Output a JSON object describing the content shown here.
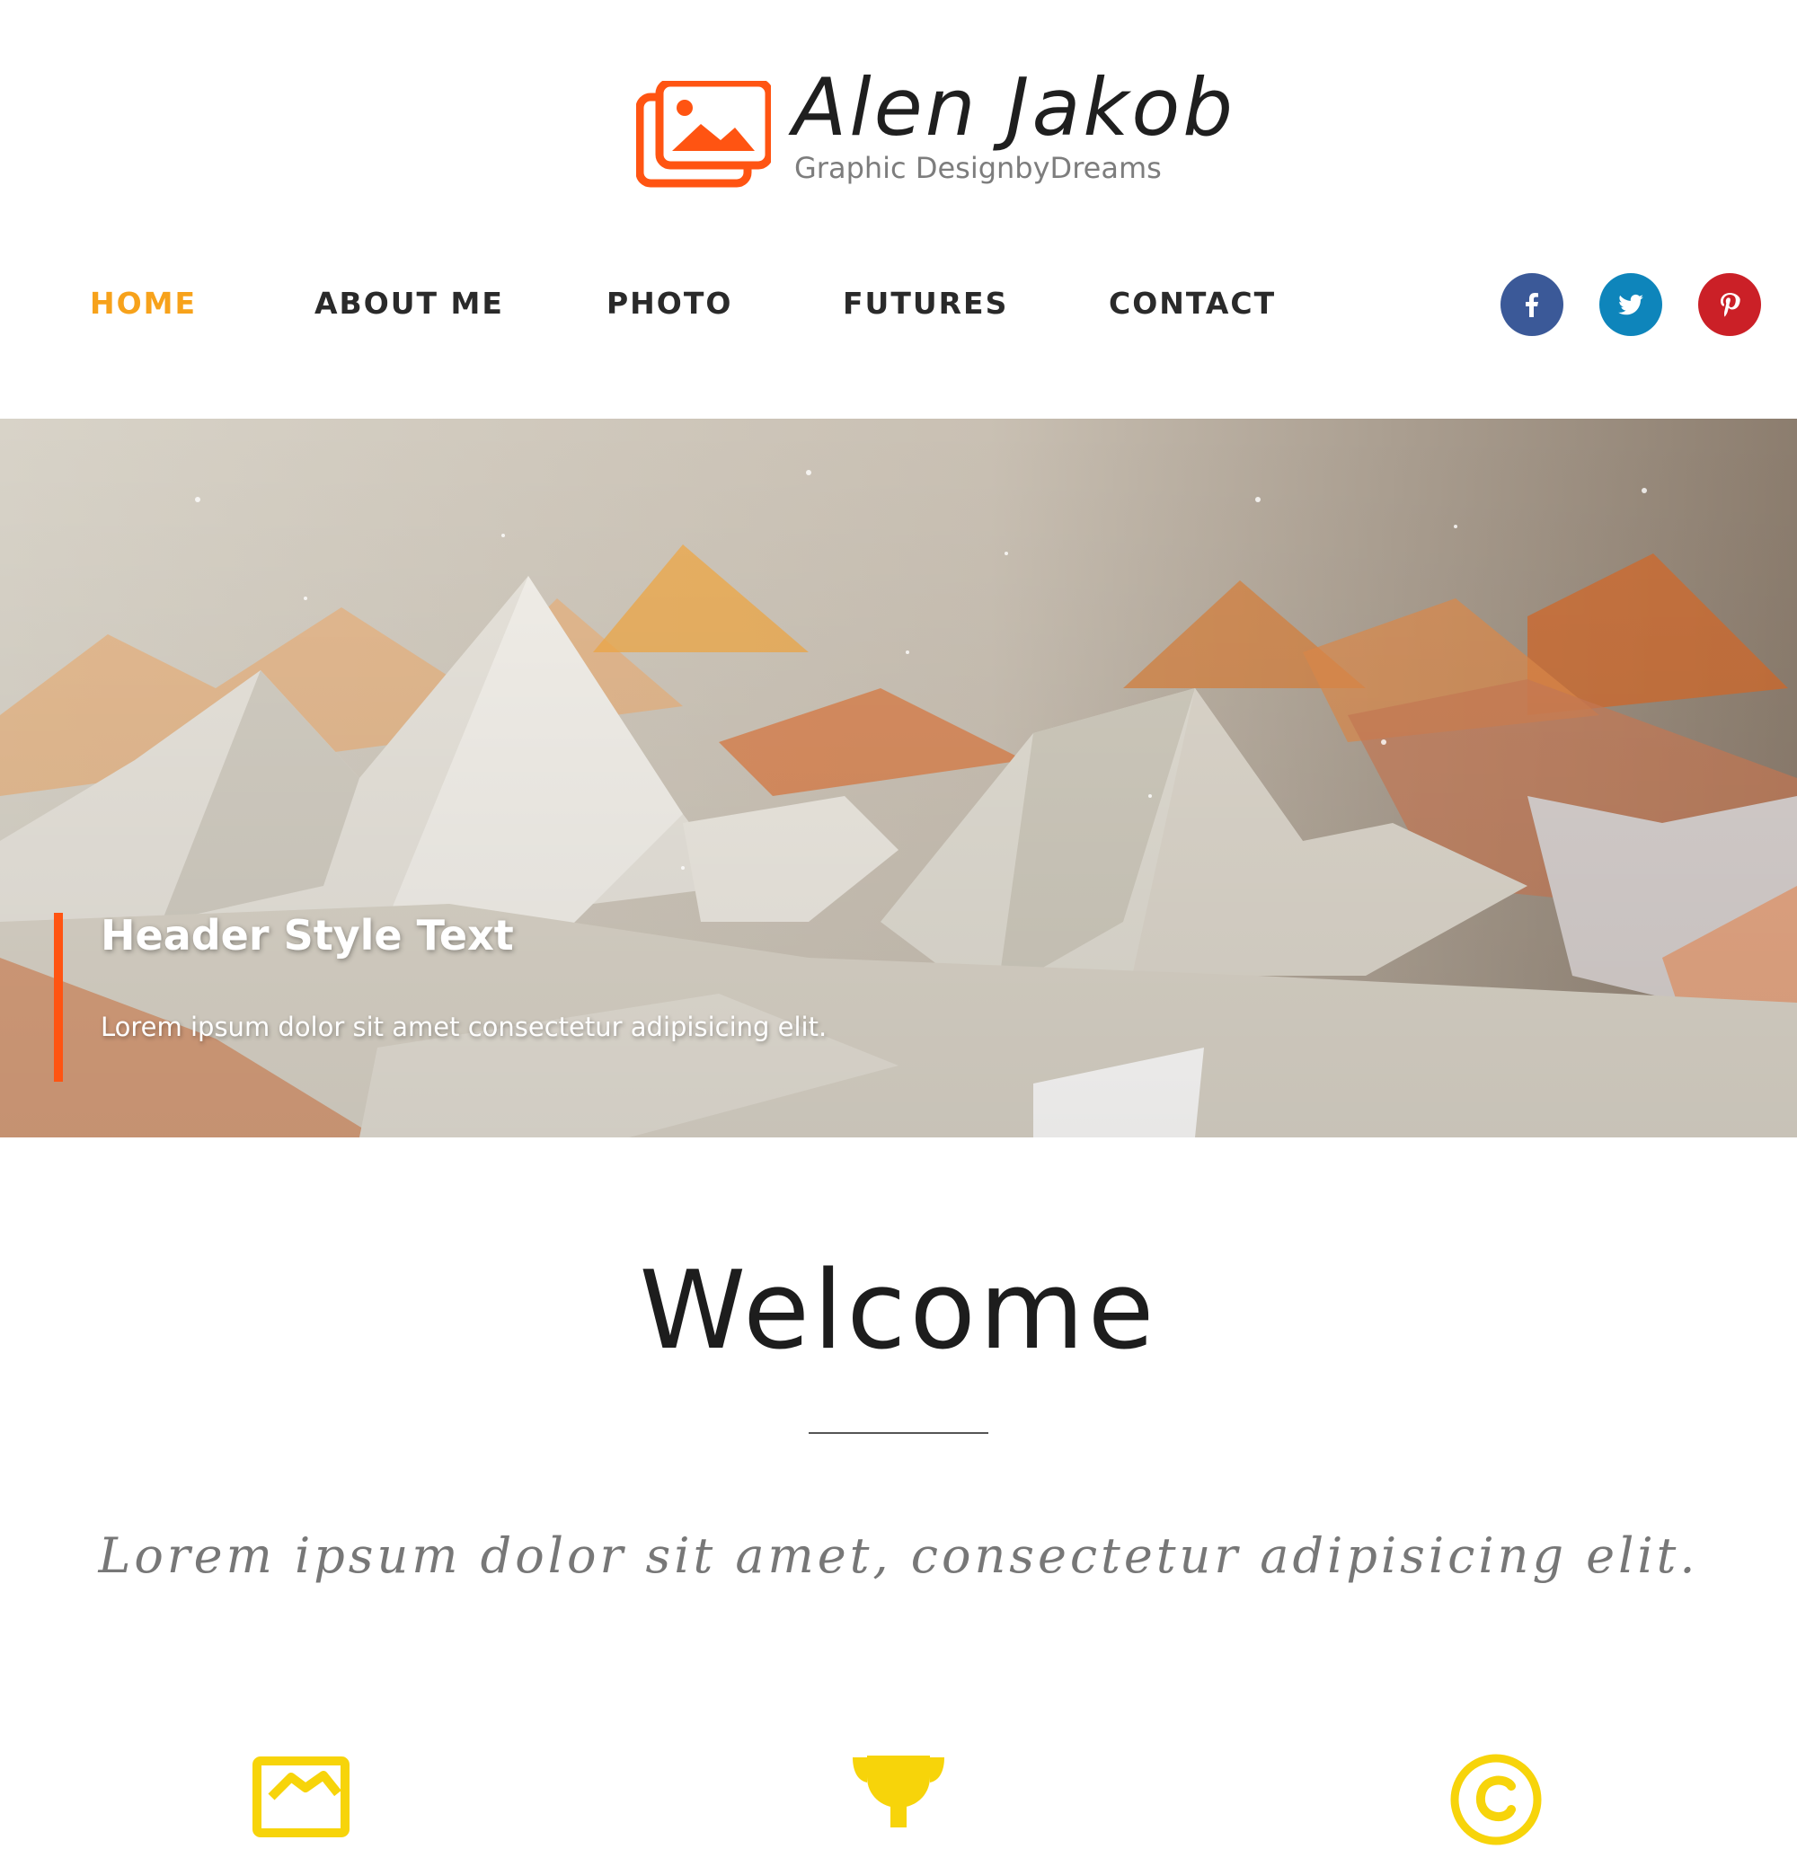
{
  "brand": {
    "name": "Alen Jakob",
    "tagline": "Graphic DesignbyDreams",
    "logo_icon": "photo-gallery-icon",
    "accent_color": "#ff5412"
  },
  "nav": {
    "items": [
      {
        "label": "HOME",
        "active": true
      },
      {
        "label": "ABOUT ME",
        "active": false
      },
      {
        "label": "PHOTO",
        "active": false
      },
      {
        "label": "FUTURES",
        "active": false
      },
      {
        "label": "CONTACT",
        "active": false
      }
    ],
    "active_color": "#f7a21b"
  },
  "social": [
    {
      "name": "facebook-icon",
      "color": "#3b5998"
    },
    {
      "name": "twitter-icon",
      "color": "#0e85bb"
    },
    {
      "name": "pinterest-icon",
      "color": "#cb2027"
    }
  ],
  "hero": {
    "title": "Header Style Text",
    "subtitle": "Lorem ipsum dolor sit amet consectetur adipisicing elit."
  },
  "welcome": {
    "title": "Welcome",
    "text": "Lorem ipsum dolor sit amet, consectetur adipisicing elit."
  },
  "features": [
    {
      "icon": "handshake-icon",
      "color": "#f7d40a"
    },
    {
      "icon": "trophy-icon",
      "color": "#f7d40a"
    },
    {
      "icon": "copyright-icon",
      "color": "#f7d40a"
    }
  ]
}
